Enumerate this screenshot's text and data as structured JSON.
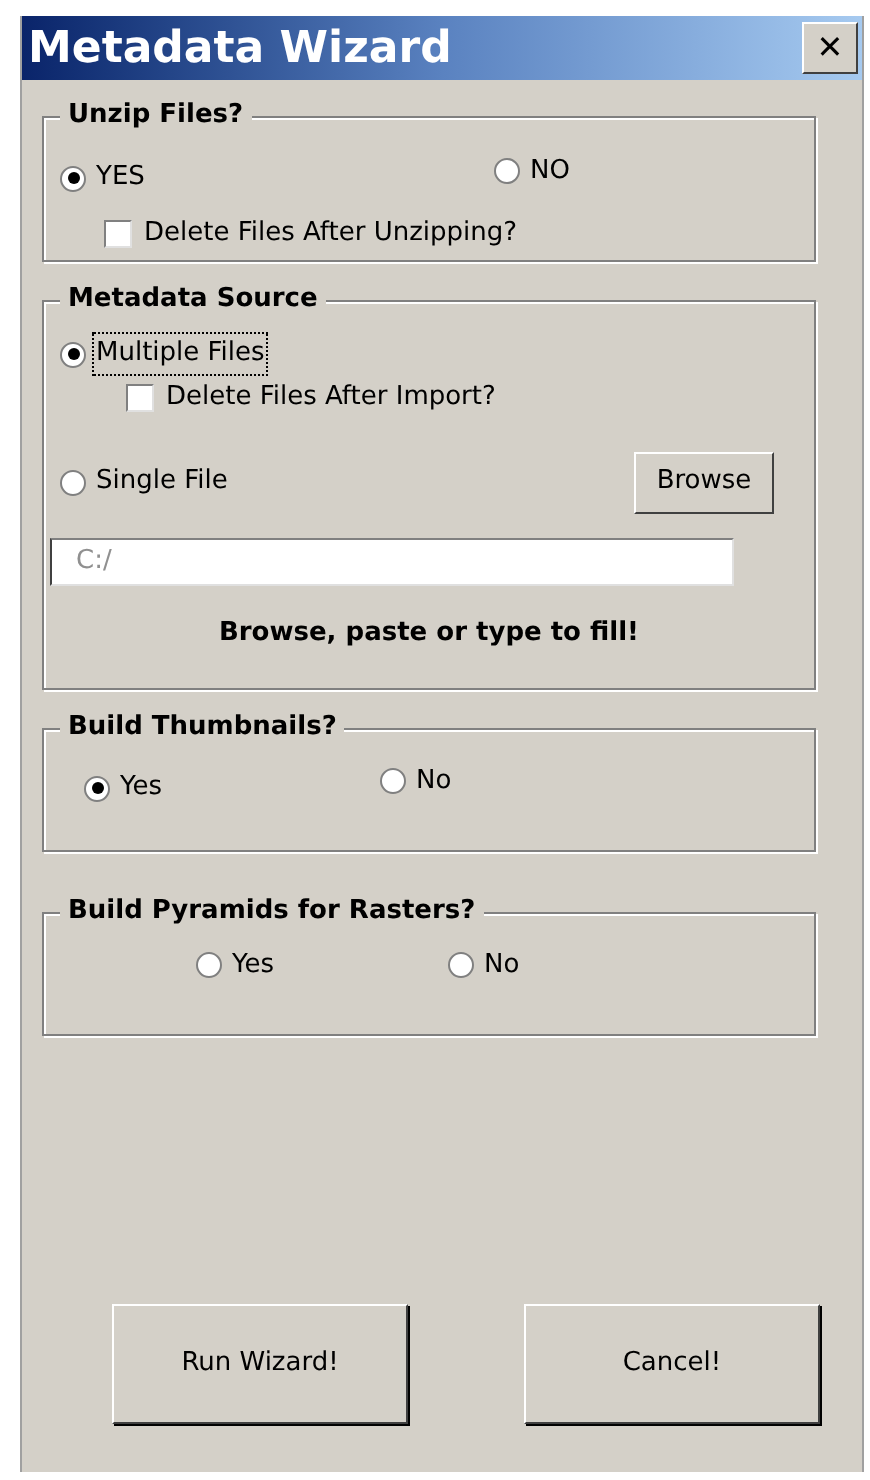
{
  "window": {
    "title": "Metadata Wizard",
    "close": "✕"
  },
  "sections": [
    {
      "title": "Unzip Files?",
      "rows": [
        {
          "kind": "radios",
          "options": [
            {
              "label": "YES",
              "selected": true
            },
            {
              "label": "NO",
              "selected": false
            }
          ]
        },
        {
          "kind": "checkbox",
          "label": "Delete Files After Unzipping?",
          "checked": false
        }
      ]
    },
    {
      "title": "Metadata Source",
      "rows": [
        {
          "kind": "radio",
          "label": "Multiple Files",
          "selected": true,
          "focused": true
        },
        {
          "kind": "checkbox",
          "label": "Delete Files After Import?",
          "checked": false
        },
        {
          "kind": "radio",
          "label": "Single File",
          "selected": false,
          "focused": false,
          "button": "Browse"
        },
        {
          "kind": "field",
          "placeholder": "C:/"
        },
        {
          "kind": "note",
          "text": "Browse, paste or type to fill!"
        }
      ]
    },
    {
      "title": "Build Thumbnails?",
      "rows": [
        {
          "kind": "radios",
          "options": [
            {
              "label": "Yes",
              "selected": true
            },
            {
              "label": "No",
              "selected": false
            }
          ]
        }
      ]
    },
    {
      "title": "Build Pyramids for Rasters?",
      "rows": [
        {
          "kind": "radios",
          "options": [
            {
              "label": "Yes",
              "selected": false
            },
            {
              "label": "No",
              "selected": false
            }
          ]
        }
      ]
    }
  ],
  "buttons": [
    "Run Wizard!",
    "Cancel!"
  ]
}
